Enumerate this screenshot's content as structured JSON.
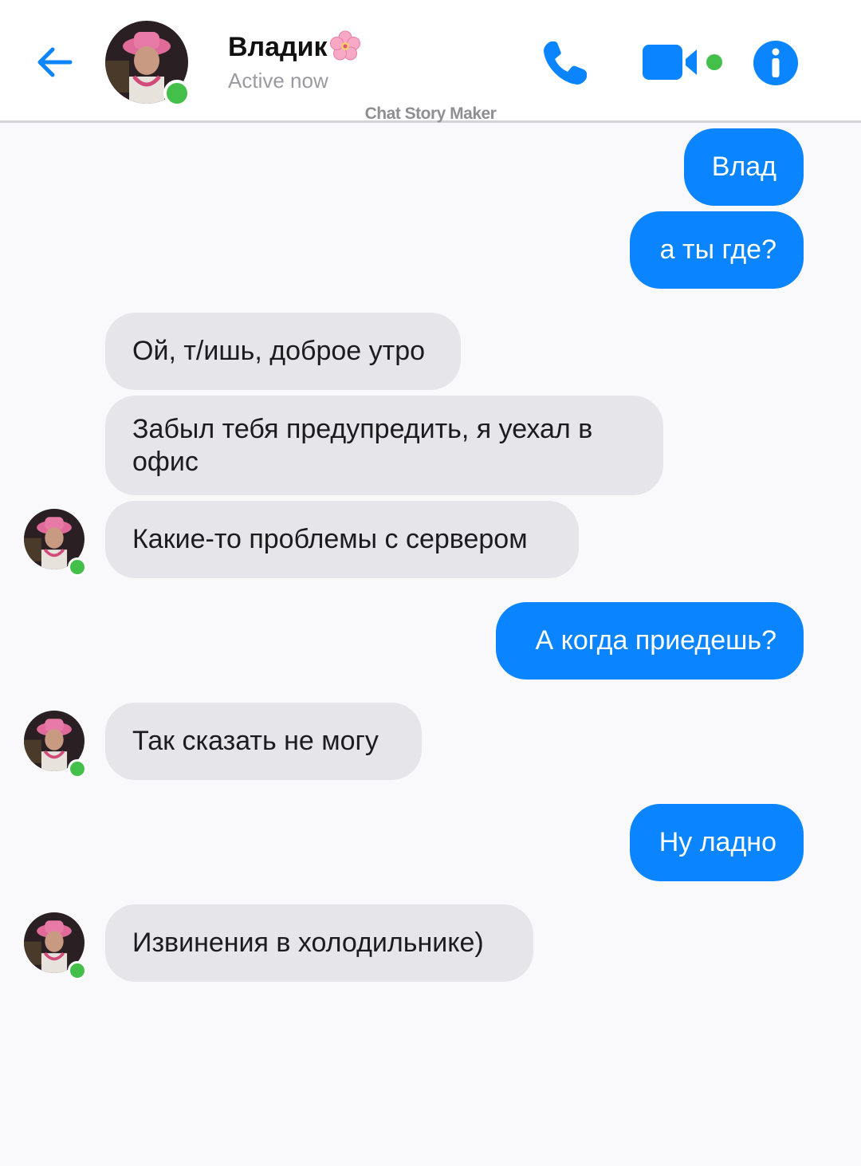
{
  "header": {
    "contact_name": "Владик",
    "status": "Active now",
    "watermark": "Chat Story Maker",
    "icons": {
      "back": "arrow-left-icon",
      "call": "phone-icon",
      "video": "video-camera-icon",
      "info": "info-icon",
      "name_emoji": "cherry-blossom-icon"
    }
  },
  "messages": [
    {
      "direction": "out",
      "text": "Влад"
    },
    {
      "direction": "out",
      "text": "а ты где?"
    },
    {
      "direction": "in",
      "text": "Ой, т/ишь, доброе утро"
    },
    {
      "direction": "in",
      "text": "Забыл тебя предупредить, я уехал в офис"
    },
    {
      "direction": "in",
      "text": "Какие-то проблемы с сервером"
    },
    {
      "direction": "out",
      "text": "А когда приедешь?"
    },
    {
      "direction": "in",
      "text": "Так сказать не могу"
    },
    {
      "direction": "out",
      "text": "Ну ладно"
    },
    {
      "direction": "in",
      "text": "Извинения в холодильнике)"
    }
  ],
  "colors": {
    "accent_blue": "#0b84ff",
    "incoming_bubble": "#e5e5ea",
    "online_green": "#44c04a",
    "background": "#f9f9fb"
  }
}
